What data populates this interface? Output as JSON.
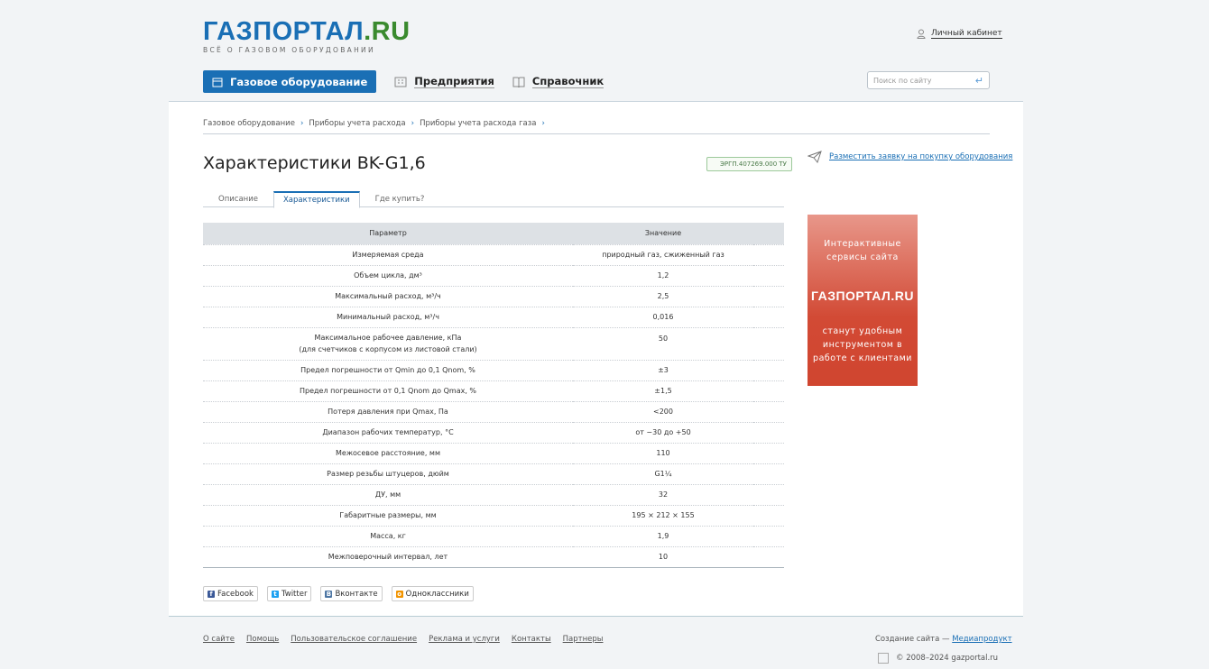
{
  "header": {
    "logo_main": "ГАЗПОРТАЛ",
    "logo_ru": ".RU",
    "tagline": "ВСЁ О ГАЗОВОМ ОБОРУДОВАНИИ",
    "cabinet": "Личный кабинет",
    "search_placeholder": "Поиск по сайту"
  },
  "nav": {
    "main": "Газовое оборудование",
    "companies": "Предприятия",
    "reference": "Справочник"
  },
  "breadcrumbs": [
    "Газовое оборудование",
    "Приборы учета расхода",
    "Приборы учета расхода газа"
  ],
  "breadcrumb_sep": "›",
  "page": {
    "title": "Характеристики BK-G1,6",
    "badge": "ЭРГП.407269.000 ТУ",
    "order_link": "Разместить заявку на покупку оборудования"
  },
  "tabs": [
    "Описание",
    "Характеристики",
    "Где купить?"
  ],
  "table": {
    "headers": [
      "Параметр",
      "Значение"
    ],
    "rows": [
      [
        "Измеряемая среда",
        "природный газ, сжиженный газ"
      ],
      [
        "Объем цикла, дм³",
        "1,2"
      ],
      [
        "Максимальный расход, м³/ч",
        "2,5"
      ],
      [
        "Минимальный расход, м³/ч",
        "0,016"
      ],
      [
        "Максимальное рабочее давление, кПа",
        "50",
        "(для счетчиков с корпусом из листовой стали)"
      ],
      [
        "Предел погрешности от Qmin до 0,1 Qnom, %",
        "±3"
      ],
      [
        "Предел погрешности от 0,1 Qnom до Qmax, %",
        "±1,5"
      ],
      [
        "Потеря давления при Qmax, Па",
        "<200"
      ],
      [
        "Диапазон рабочих температур, °С",
        "от −30 до +50"
      ],
      [
        "Межосевое расстояние, мм",
        "110"
      ],
      [
        "Размер резьбы штуцеров, дюйм",
        "G1¼"
      ],
      [
        "ДУ, мм",
        "32"
      ],
      [
        "Габаритные размеры, мм",
        "195 × 212 × 155"
      ],
      [
        "Масса, кг",
        "1,9"
      ],
      [
        "Межповерочный интервал, лет",
        "10"
      ]
    ]
  },
  "ad": {
    "line1": "Интерактивные сервисы сайта",
    "logo": "ГАЗПОРТАЛ.RU",
    "line2": "станут удобным инструментом в работе с клиентами"
  },
  "share": [
    "Facebook",
    "Twitter",
    "Вконтакте",
    "Одноклассники"
  ],
  "footer": {
    "links": [
      "О сайте",
      "Помощь",
      "Пользовательское соглашение",
      "Реклама и услуги",
      "Контакты",
      "Партнеры"
    ],
    "made_by": "Создание сайта —",
    "made_link": "Медиапродукт",
    "copyright": "© 2008–2024 gazportal.ru"
  },
  "colors": {
    "brand": "#1a6fb5",
    "green": "#3a8a2e",
    "ad": "#d24a35"
  }
}
